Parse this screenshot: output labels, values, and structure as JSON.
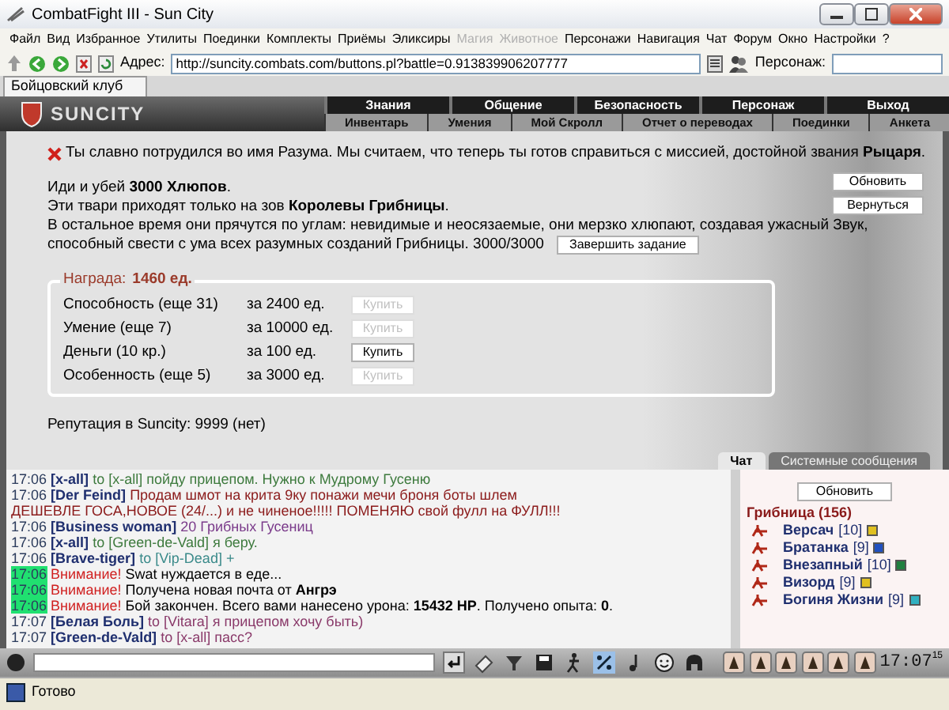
{
  "window": {
    "title": "CombatFight III - Sun City"
  },
  "menu": [
    {
      "label": "Файл",
      "disabled": false
    },
    {
      "label": "Вид",
      "disabled": false
    },
    {
      "label": "Избранное",
      "disabled": false
    },
    {
      "label": "Утилиты",
      "disabled": false
    },
    {
      "label": "Поединки",
      "disabled": false
    },
    {
      "label": "Комплекты",
      "disabled": false
    },
    {
      "label": "Приёмы",
      "disabled": false
    },
    {
      "label": "Эликсиры",
      "disabled": false
    },
    {
      "label": "Магия",
      "disabled": true
    },
    {
      "label": "Животное",
      "disabled": true
    },
    {
      "label": "Персонажи",
      "disabled": false
    },
    {
      "label": "Навигация",
      "disabled": false
    },
    {
      "label": "Чат",
      "disabled": false
    },
    {
      "label": "Форум",
      "disabled": false
    },
    {
      "label": "Окно",
      "disabled": false
    },
    {
      "label": "Настройки",
      "disabled": false
    },
    {
      "label": "?",
      "disabled": false
    }
  ],
  "address_bar": {
    "label": "Адрес:",
    "value": "http://suncity.combats.com/buttons.pl?battle=0.913839906207777"
  },
  "character_field": {
    "label": "Персонаж:"
  },
  "tabs": [
    {
      "label": "Бойцовский клуб",
      "selected": true
    }
  ],
  "game_header": {
    "logo": "SUNCITY",
    "nav": [
      "Знания",
      "Общение",
      "Безопасность",
      "Персонаж",
      "Выход"
    ],
    "subnav": [
      "Инвентарь",
      "Умения",
      "Мой Скролл",
      "Отчет о переводах",
      "Поединки",
      "Анкета"
    ]
  },
  "quest": {
    "intro": "Ты славно потрудился во имя Разума. Мы считаем, что теперь ты готов справиться с миссией, достойной звания **Рыцаря**.",
    "lines": [
      "Иди и убей **3000 Хлюпов**.",
      "Эти твари приходят только на зов **Королевы Грибницы**.",
      "В остальное время они прячутся по углам: невидимые и неосязаемые, они мерзко хлюпают, создавая ужасный Звук,",
      "способный свести с ума всех разумных созданий Грибницы. 3000/3000"
    ],
    "complete_button": "Завершить задание",
    "side_buttons": [
      "Обновить",
      "Вернуться"
    ]
  },
  "reward": {
    "label": "Награда:",
    "amount": "1460 ед.",
    "items": [
      {
        "name": "Способность (еще 31)",
        "price": "за 2400 ед.",
        "button": "Купить",
        "disabled": true
      },
      {
        "name": "Умение (еще 7)",
        "price": "за 10000 ед.",
        "button": "Купить",
        "disabled": true
      },
      {
        "name": "Деньги (10 кр.)",
        "price": "за 100 ед.",
        "button": "Купить",
        "disabled": false
      },
      {
        "name": "Особенность (еще 5)",
        "price": "за 3000 ед.",
        "button": "Купить",
        "disabled": true
      }
    ]
  },
  "reputation": "Репутация в Suncity: 9999 (нет)",
  "chat": {
    "tabs": [
      {
        "label": "Чат",
        "selected": true
      },
      {
        "label": "Системные сообщения",
        "selected": false
      }
    ],
    "lines": [
      {
        "kind": "message",
        "time": "17:06",
        "sender": "[x-all]",
        "recipient": "to [x-all]",
        "text": "пойду прицепом. Нужно к Мудрому Гусеню",
        "color": "#3d7a3d"
      },
      {
        "kind": "message",
        "time": "17:06",
        "sender": "[Der Feind]",
        "text": "Продам шмот на крита 9ку понажи мечи броня боты шлем",
        "continuation": "ДЕШЕВЛЕ ГОСА,НОВОЕ (24/...) и не чиненое!!!!! ПОМЕНЯЮ свой фулл на ФУЛЛ!!!",
        "color": "#8b1a1a"
      },
      {
        "kind": "message",
        "time": "17:06",
        "sender": "[Business woman]",
        "text": "20 Грибных Гусениц",
        "color": "#7a3a8a"
      },
      {
        "kind": "message",
        "time": "17:06",
        "sender": "[x-all]",
        "recipient": "to [Green-de-Vald]",
        "text": "я беру.",
        "color": "#3d7a3d"
      },
      {
        "kind": "message",
        "time": "17:06",
        "sender": "[Brave-tiger]",
        "recipient": "to [Vip-Dead]",
        "text": "+",
        "color": "#3a8a8a"
      },
      {
        "kind": "system",
        "time": "17:06",
        "label": "Внимание!",
        "text": "Swat нуждается в еде..."
      },
      {
        "kind": "system",
        "time": "17:06",
        "label": "Внимание!",
        "text": "Получена новая почта от **Ангрэ**"
      },
      {
        "kind": "system",
        "time": "17:06",
        "label": "Внимание!",
        "text": "Бой закончен. Всего вами нанесено урона: **15432 HP**. Получено опыта: **0**."
      },
      {
        "kind": "message",
        "time": "17:07",
        "sender": "[Белая Боль]",
        "recipient": "to [Vitara]",
        "text": "я прицепом хочу быть)",
        "color": "#8a3a6a"
      },
      {
        "kind": "message",
        "time": "17:07",
        "sender": "[Green-de-Vald]",
        "recipient": "to [x-all]",
        "text": "пасс?",
        "color": "#8a3a6a"
      }
    ]
  },
  "online": {
    "refresh_button": "Обновить",
    "room": "Грибница (156)",
    "users": [
      {
        "name": "Версач",
        "level": "[10]",
        "color": "#e0c020"
      },
      {
        "name": "Братанка",
        "level": "[9]",
        "color": "#2050c0"
      },
      {
        "name": "Внезапный",
        "level": "[10]",
        "color": "#208040"
      },
      {
        "name": "Визорд",
        "level": "[9]",
        "color": "#e0c020"
      },
      {
        "name": "Богиня Жизни",
        "level": "[9]",
        "color": "#30b0c0"
      }
    ]
  },
  "clock": {
    "time": "17:07",
    "seconds": "15"
  },
  "status_bar": {
    "text": "Готово"
  }
}
